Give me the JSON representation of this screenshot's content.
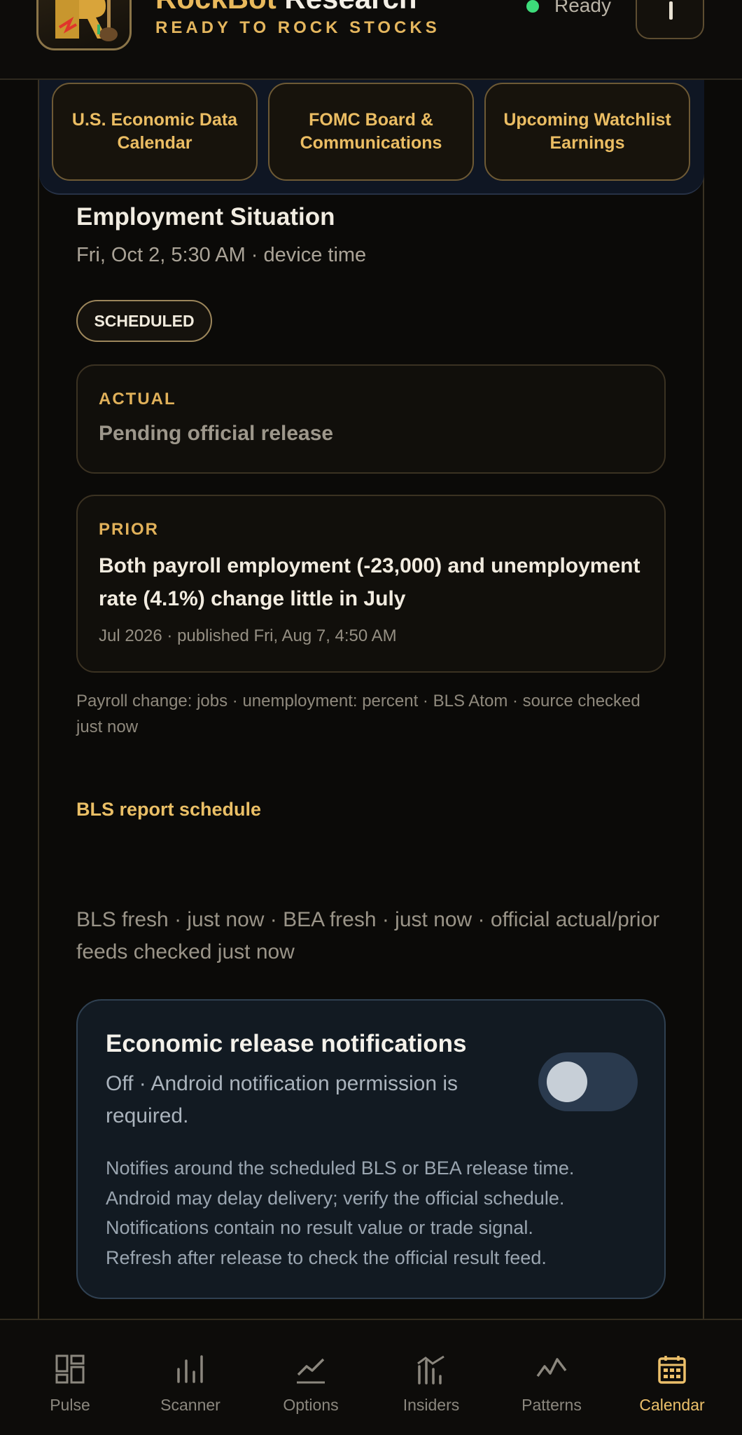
{
  "header": {
    "brand_part1": "RockBot",
    "brand_part2": " Research",
    "tagline": "READY TO ROCK STOCKS",
    "status": "Ready",
    "status_color": "#3ddc7a",
    "menu_icon": "more-icon"
  },
  "quick_links": [
    {
      "label": "U.S. Economic Data Calendar"
    },
    {
      "label": "FOMC Board & Communications"
    },
    {
      "label": "Upcoming Watchlist Earnings"
    }
  ],
  "event": {
    "title": "Employment Situation",
    "time": "Fri, Oct 2, 5:30 AM · device time",
    "badge": "SCHEDULED",
    "actual": {
      "label": "ACTUAL",
      "value": "Pending official release"
    },
    "prior": {
      "label": "PRIOR",
      "headline": "Both payroll employment (-23,000) and unemployment rate (4.1%) change little in July",
      "meta": "Jul 2026 · published Fri, Aug 7, 4:50 AM"
    },
    "units_note": "Payroll change: jobs · unemployment: percent · BLS Atom · source checked just now",
    "schedule_link": "BLS report schedule",
    "freshness": "BLS fresh · just now · BEA fresh · just now · official actual/prior feeds checked just now"
  },
  "notifications": {
    "title": "Economic release notifications",
    "status": "Off · Android notification permission is required.",
    "toggle_on": false,
    "lines": [
      "Notifies around the scheduled BLS or BEA release time.",
      "Android may delay delivery; verify the official schedule.",
      "Notifications contain no result value or trade signal.",
      "Refresh after release to check the official result feed."
    ]
  },
  "nav": [
    {
      "label": "Pulse",
      "icon": "dashboard-icon",
      "active": false
    },
    {
      "label": "Scanner",
      "icon": "bar-chart-icon",
      "active": false
    },
    {
      "label": "Options",
      "icon": "line-chart-icon",
      "active": false
    },
    {
      "label": "Insiders",
      "icon": "insider-chart-icon",
      "active": false
    },
    {
      "label": "Patterns",
      "icon": "pattern-icon",
      "active": false
    },
    {
      "label": "Calendar",
      "icon": "calendar-icon",
      "active": true
    }
  ],
  "colors": {
    "accent": "#e9b95c",
    "background": "#0b0a08",
    "card_border": "#3b3222",
    "notif_bg": "#121a22"
  }
}
